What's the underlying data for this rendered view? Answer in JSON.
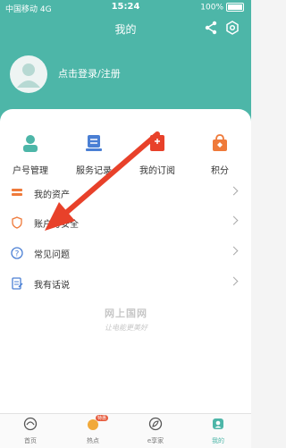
{
  "status_bar": {
    "carrier": "中国移动",
    "network": "4G",
    "time": "15:24",
    "battery": "100%"
  },
  "header": {
    "title": "我的",
    "login_text": "点击登录/注册"
  },
  "quick_actions": [
    {
      "label": "户号管理",
      "icon": "user-account-icon"
    },
    {
      "label": "服务记录",
      "icon": "service-record-icon"
    },
    {
      "label": "我的订阅",
      "icon": "subscription-icon"
    },
    {
      "label": "积分",
      "icon": "points-bag-icon"
    }
  ],
  "menu": [
    {
      "label": "我的资产",
      "icon": "assets-icon"
    },
    {
      "label": "账户与安全",
      "icon": "security-shield-icon"
    },
    {
      "label": "常见问题",
      "icon": "question-icon"
    },
    {
      "label": "我有话说",
      "icon": "feedback-icon"
    }
  ],
  "watermark": {
    "line1": "网上国网",
    "line2": "让电能更美好"
  },
  "tabs": [
    {
      "label": "首页",
      "icon": "home-icon"
    },
    {
      "label": "热点",
      "icon": "hot-icon",
      "badge": "特惠"
    },
    {
      "label": "e享家",
      "icon": "leaf-icon"
    },
    {
      "label": "我的",
      "icon": "me-icon",
      "active": true
    }
  ],
  "colors": {
    "primary": "#4db6a8",
    "arrow": "#e8412a",
    "accent_orange": "#ef7a3a",
    "accent_blue": "#4a7fd4"
  }
}
